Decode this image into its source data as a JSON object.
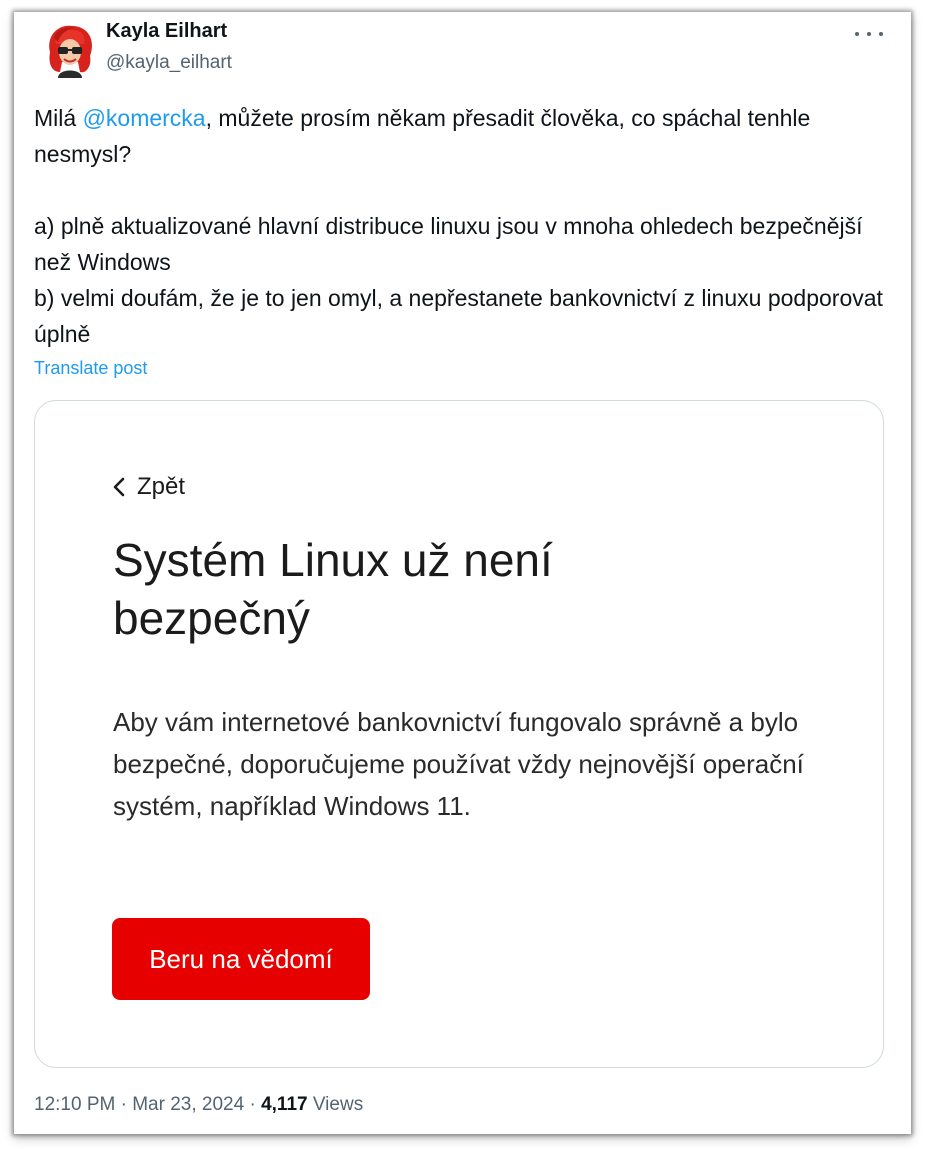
{
  "author": {
    "name": "Kayla Eilhart",
    "handle": "@kayla_eilhart",
    "avatar_icon": "red-haired-avatar"
  },
  "tweet": {
    "line1_prefix": "Milá ",
    "mention": "@komercka",
    "line1_suffix": ", můžete prosím někam přesadit člověka, co spáchal tenhle nesmysl?",
    "point_a": "a) plně aktualizované hlavní distribuce linuxu jsou v mnoha ohledech bezpečnější než Windows",
    "point_b": "b) velmi doufám, že je to jen omyl, a nepřestanete bankovnictví z linuxu podporovat úplně",
    "translate_label": "Translate post"
  },
  "media": {
    "back_label": "Zpět",
    "headline": "Systém Linux už není bezpečný",
    "body": "Aby vám internetové bankovnictví fungovalo správně a bylo bezpečné, doporučujeme používat vždy nejnovější operační systém, například Windows 11.",
    "button_label": "Beru na vědomí"
  },
  "meta": {
    "time": "12:10 PM",
    "separator": " · ",
    "date": "Mar 23, 2024",
    "views_count": "4,117",
    "views_label": " Views"
  },
  "colors": {
    "accent": "#1d9bf0",
    "button": "#e60000",
    "text": "#0f1419",
    "secondary": "#536471"
  }
}
